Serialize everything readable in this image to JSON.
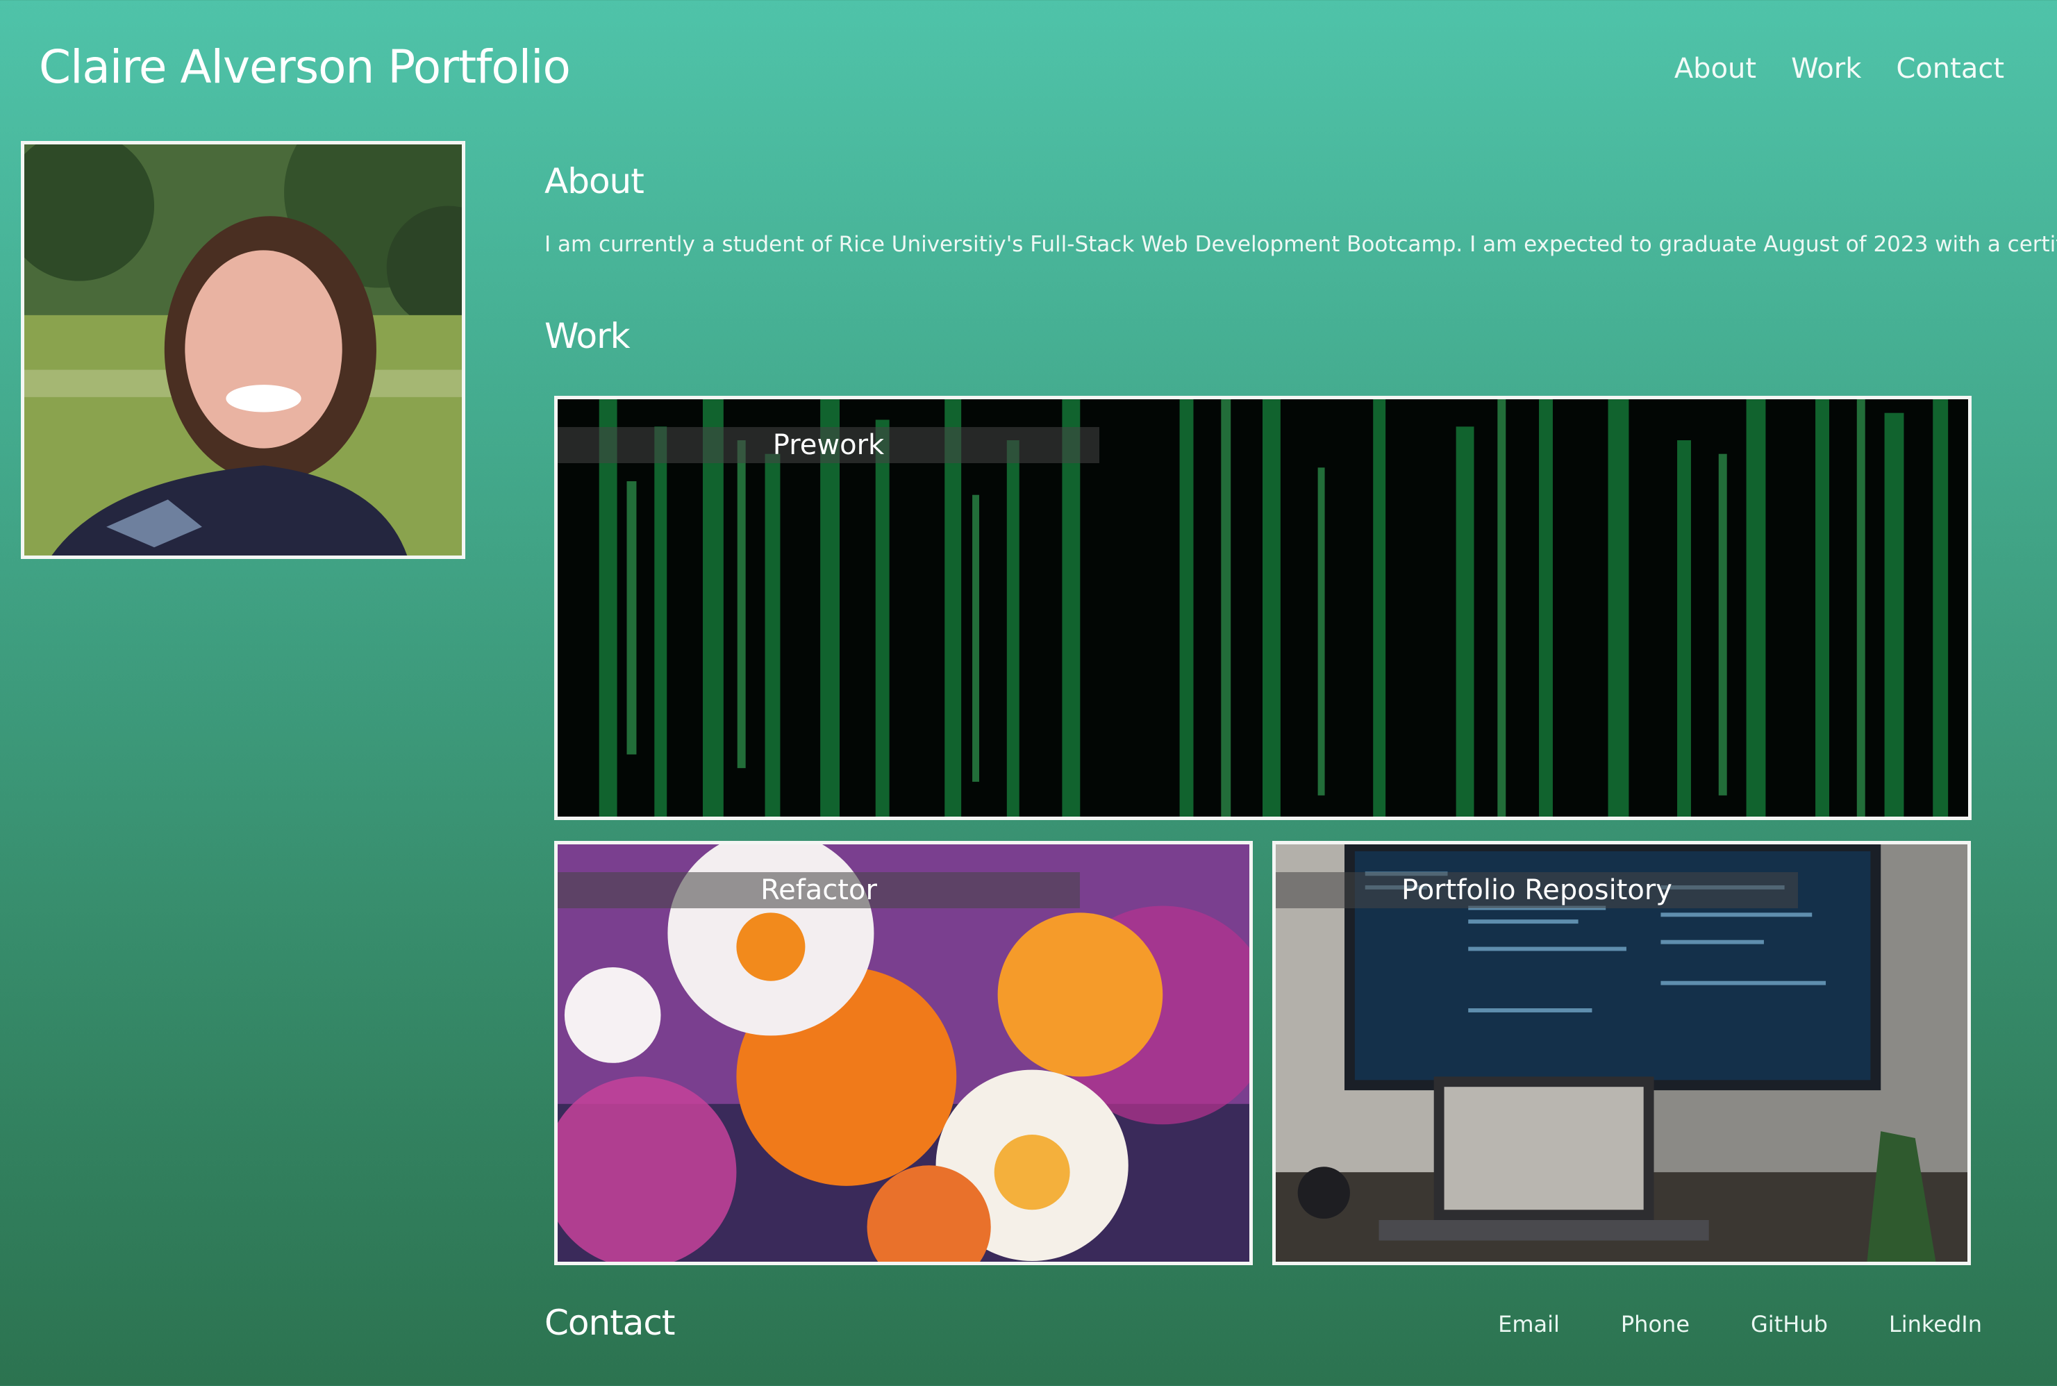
{
  "header": {
    "title": "Claire Alverson Portfolio",
    "nav": [
      "About",
      "Work",
      "Contact"
    ]
  },
  "profile": {
    "icon": "profile-photo"
  },
  "about": {
    "heading": "About",
    "text": "I am currently a student of Rice Universitiy's Full-Stack Web Development Bootcamp. I am expected to graduate August of 2023 with a certificate."
  },
  "work": {
    "heading": "Work",
    "projects": [
      {
        "label": "Prework",
        "icon": "green-code-rain-image"
      },
      {
        "label": "Refactor",
        "icon": "flowers-image"
      },
      {
        "label": "Portfolio Repository",
        "icon": "computer-monitor-image"
      }
    ]
  },
  "contact": {
    "heading": "Contact",
    "links": [
      "Email",
      "Phone",
      "GitHub",
      "LinkedIn"
    ]
  },
  "colors": {
    "accent": "#4fc3a9",
    "background_bottom": "#2c7350",
    "border": "#f4f6f4"
  }
}
